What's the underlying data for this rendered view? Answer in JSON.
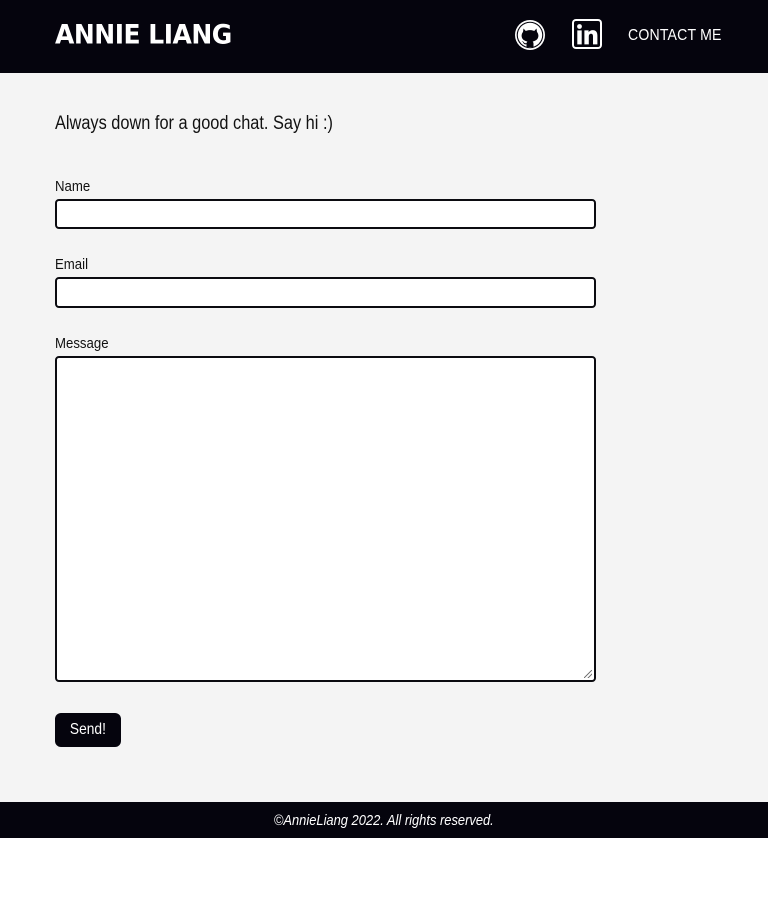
{
  "header": {
    "brand": "ANNIE LIANG",
    "github_icon": "github-icon",
    "linkedin_icon": "linkedin-icon",
    "contact_label": "CONTACT ME"
  },
  "main": {
    "intro": "Always down for a good chat. Say hi :)",
    "form": {
      "name_label": "Name",
      "name_value": "",
      "email_label": "Email",
      "email_value": "",
      "message_label": "Message",
      "message_value": "",
      "send_label": "Send!"
    }
  },
  "footer": {
    "text": "©AnnieLiang 2022. All rights reserved."
  },
  "colors": {
    "header_bg": "#05040d",
    "page_bg": "#f4f4f4",
    "field_border": "#0b0b10"
  }
}
